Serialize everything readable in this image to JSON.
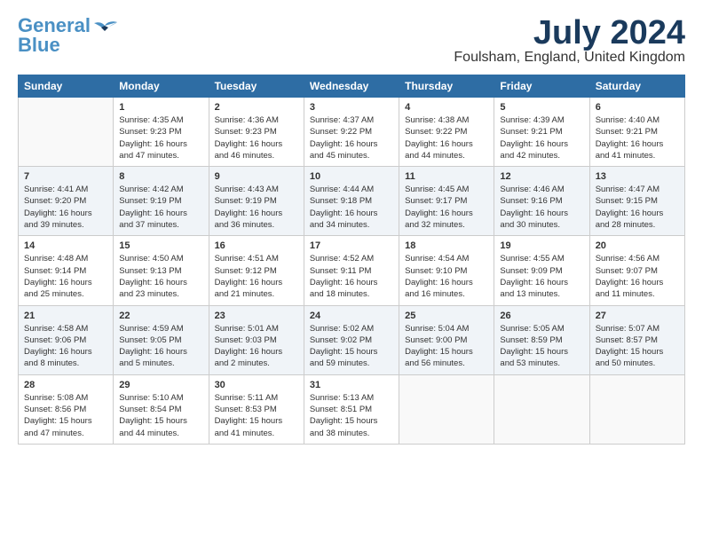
{
  "logo": {
    "line1": "General",
    "line2": "Blue"
  },
  "title": "July 2024",
  "location": "Foulsham, England, United Kingdom",
  "days_header": [
    "Sunday",
    "Monday",
    "Tuesday",
    "Wednesday",
    "Thursday",
    "Friday",
    "Saturday"
  ],
  "weeks": [
    [
      {
        "day": "",
        "content": ""
      },
      {
        "day": "1",
        "content": "Sunrise: 4:35 AM\nSunset: 9:23 PM\nDaylight: 16 hours\nand 47 minutes."
      },
      {
        "day": "2",
        "content": "Sunrise: 4:36 AM\nSunset: 9:23 PM\nDaylight: 16 hours\nand 46 minutes."
      },
      {
        "day": "3",
        "content": "Sunrise: 4:37 AM\nSunset: 9:22 PM\nDaylight: 16 hours\nand 45 minutes."
      },
      {
        "day": "4",
        "content": "Sunrise: 4:38 AM\nSunset: 9:22 PM\nDaylight: 16 hours\nand 44 minutes."
      },
      {
        "day": "5",
        "content": "Sunrise: 4:39 AM\nSunset: 9:21 PM\nDaylight: 16 hours\nand 42 minutes."
      },
      {
        "day": "6",
        "content": "Sunrise: 4:40 AM\nSunset: 9:21 PM\nDaylight: 16 hours\nand 41 minutes."
      }
    ],
    [
      {
        "day": "7",
        "content": "Sunrise: 4:41 AM\nSunset: 9:20 PM\nDaylight: 16 hours\nand 39 minutes."
      },
      {
        "day": "8",
        "content": "Sunrise: 4:42 AM\nSunset: 9:19 PM\nDaylight: 16 hours\nand 37 minutes."
      },
      {
        "day": "9",
        "content": "Sunrise: 4:43 AM\nSunset: 9:19 PM\nDaylight: 16 hours\nand 36 minutes."
      },
      {
        "day": "10",
        "content": "Sunrise: 4:44 AM\nSunset: 9:18 PM\nDaylight: 16 hours\nand 34 minutes."
      },
      {
        "day": "11",
        "content": "Sunrise: 4:45 AM\nSunset: 9:17 PM\nDaylight: 16 hours\nand 32 minutes."
      },
      {
        "day": "12",
        "content": "Sunrise: 4:46 AM\nSunset: 9:16 PM\nDaylight: 16 hours\nand 30 minutes."
      },
      {
        "day": "13",
        "content": "Sunrise: 4:47 AM\nSunset: 9:15 PM\nDaylight: 16 hours\nand 28 minutes."
      }
    ],
    [
      {
        "day": "14",
        "content": "Sunrise: 4:48 AM\nSunset: 9:14 PM\nDaylight: 16 hours\nand 25 minutes."
      },
      {
        "day": "15",
        "content": "Sunrise: 4:50 AM\nSunset: 9:13 PM\nDaylight: 16 hours\nand 23 minutes."
      },
      {
        "day": "16",
        "content": "Sunrise: 4:51 AM\nSunset: 9:12 PM\nDaylight: 16 hours\nand 21 minutes."
      },
      {
        "day": "17",
        "content": "Sunrise: 4:52 AM\nSunset: 9:11 PM\nDaylight: 16 hours\nand 18 minutes."
      },
      {
        "day": "18",
        "content": "Sunrise: 4:54 AM\nSunset: 9:10 PM\nDaylight: 16 hours\nand 16 minutes."
      },
      {
        "day": "19",
        "content": "Sunrise: 4:55 AM\nSunset: 9:09 PM\nDaylight: 16 hours\nand 13 minutes."
      },
      {
        "day": "20",
        "content": "Sunrise: 4:56 AM\nSunset: 9:07 PM\nDaylight: 16 hours\nand 11 minutes."
      }
    ],
    [
      {
        "day": "21",
        "content": "Sunrise: 4:58 AM\nSunset: 9:06 PM\nDaylight: 16 hours\nand 8 minutes."
      },
      {
        "day": "22",
        "content": "Sunrise: 4:59 AM\nSunset: 9:05 PM\nDaylight: 16 hours\nand 5 minutes."
      },
      {
        "day": "23",
        "content": "Sunrise: 5:01 AM\nSunset: 9:03 PM\nDaylight: 16 hours\nand 2 minutes."
      },
      {
        "day": "24",
        "content": "Sunrise: 5:02 AM\nSunset: 9:02 PM\nDaylight: 15 hours\nand 59 minutes."
      },
      {
        "day": "25",
        "content": "Sunrise: 5:04 AM\nSunset: 9:00 PM\nDaylight: 15 hours\nand 56 minutes."
      },
      {
        "day": "26",
        "content": "Sunrise: 5:05 AM\nSunset: 8:59 PM\nDaylight: 15 hours\nand 53 minutes."
      },
      {
        "day": "27",
        "content": "Sunrise: 5:07 AM\nSunset: 8:57 PM\nDaylight: 15 hours\nand 50 minutes."
      }
    ],
    [
      {
        "day": "28",
        "content": "Sunrise: 5:08 AM\nSunset: 8:56 PM\nDaylight: 15 hours\nand 47 minutes."
      },
      {
        "day": "29",
        "content": "Sunrise: 5:10 AM\nSunset: 8:54 PM\nDaylight: 15 hours\nand 44 minutes."
      },
      {
        "day": "30",
        "content": "Sunrise: 5:11 AM\nSunset: 8:53 PM\nDaylight: 15 hours\nand 41 minutes."
      },
      {
        "day": "31",
        "content": "Sunrise: 5:13 AM\nSunset: 8:51 PM\nDaylight: 15 hours\nand 38 minutes."
      },
      {
        "day": "",
        "content": ""
      },
      {
        "day": "",
        "content": ""
      },
      {
        "day": "",
        "content": ""
      }
    ]
  ]
}
